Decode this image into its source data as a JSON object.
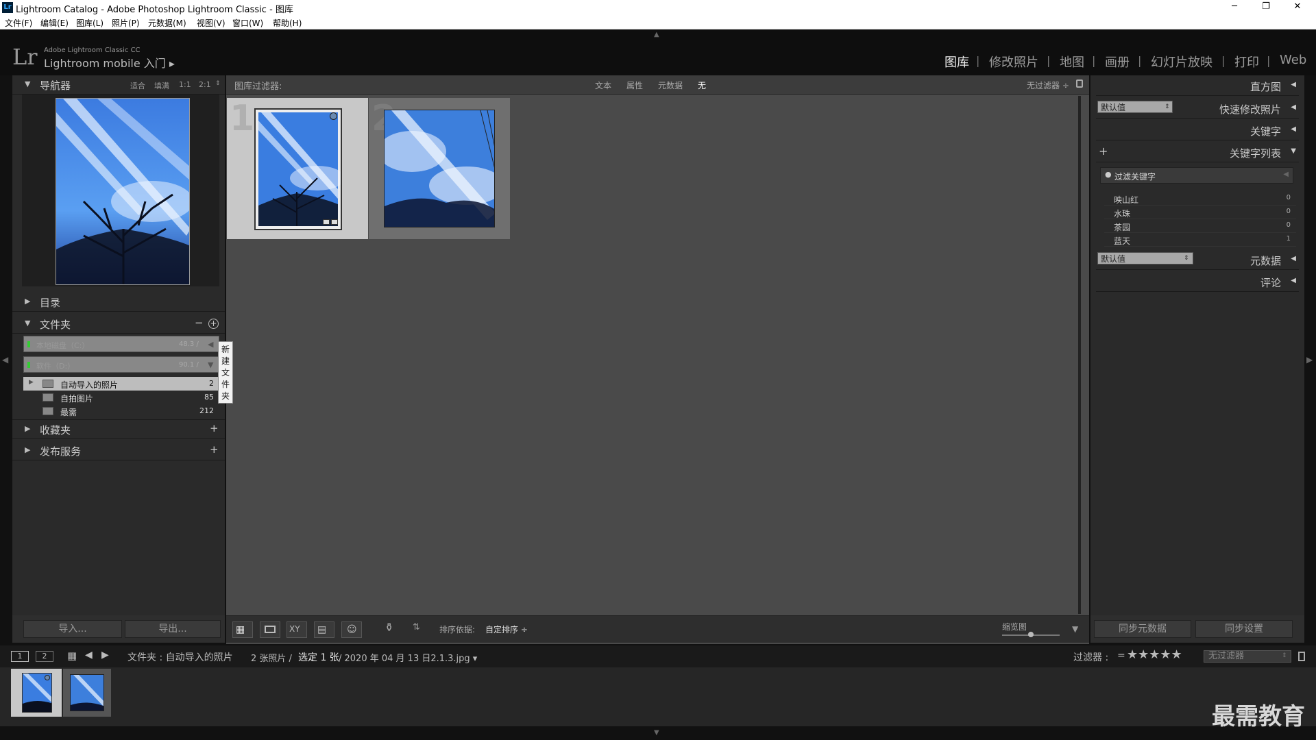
{
  "window": {
    "title": "Lightroom Catalog - Adobe Photoshop Lightroom Classic - 图库",
    "app_icon": "Lr",
    "minimize": "─",
    "restore": "❐",
    "close": "✕"
  },
  "menu": [
    "文件(F)",
    "编辑(E)",
    "图库(L)",
    "照片(P)",
    "元数据(M)",
    "视图(V)",
    "窗口(W)",
    "帮助(H)"
  ],
  "identity": {
    "logo": "Lr",
    "product": "Adobe Lightroom Classic CC",
    "mobile": "Lightroom mobile 入门 ▸"
  },
  "modules": [
    "图库",
    "修改照片",
    "地图",
    "画册",
    "幻灯片放映",
    "打印",
    "Web"
  ],
  "module_sep": "|",
  "left": {
    "navigator": {
      "label": "导航器",
      "zoom": [
        "适合",
        "填满",
        "1:1",
        "2:1"
      ]
    },
    "catalog": {
      "label": "目录"
    },
    "folders": {
      "label": "文件夹",
      "minus": "−",
      "plus": "+",
      "tooltip": "新建文件夹",
      "volumes": [
        {
          "name": "本地磁盘（C:）",
          "size": "48.3 /"
        },
        {
          "name": "软件（D:）",
          "size": "90.1 /"
        }
      ],
      "items": [
        {
          "name": "自动导入的照片",
          "count": "2"
        },
        {
          "name": "自拍图片",
          "count": "85"
        },
        {
          "name": "最需",
          "count": "212"
        }
      ]
    },
    "collections": {
      "label": "收藏夹",
      "plus": "+"
    },
    "publish": {
      "label": "发布服务",
      "plus": "+"
    },
    "import_btn": "导入...",
    "export_btn": "导出..."
  },
  "filter_bar": {
    "label": "图库过滤器:",
    "options": [
      "文本",
      "属性",
      "元数据",
      "无"
    ],
    "preset": "无过滤器 ÷"
  },
  "grid": {
    "cells": [
      "1",
      "2"
    ]
  },
  "toolbar": {
    "sort_label": "排序依据:",
    "sort_value": "自定排序 ÷",
    "thumb_label": "缩览图"
  },
  "right": {
    "histogram": "直方图",
    "quick_dev": "快速修改照片",
    "preset_default": "默认值",
    "keywording": "关键字",
    "keyword_list": "关键字列表",
    "add": "+",
    "filter_placeholder": "过滤关键字",
    "keywords": [
      {
        "name": "映山红",
        "count": "0"
      },
      {
        "name": "水珠",
        "count": "0"
      },
      {
        "name": "茶园",
        "count": "0"
      },
      {
        "name": "蓝天",
        "count": "1"
      }
    ],
    "metadata": "元数据",
    "metadata_default": "默认值",
    "comments": "评论",
    "sync_meta": "同步元数据",
    "sync_settings": "同步设置"
  },
  "filmstrip": {
    "page1": "1",
    "page2": "2",
    "path": "文件夹 : 自动导入的照片",
    "count": "2 张照片 /",
    "selected": "选定 1 张",
    "filename": "/ 2020 年 04 月 13 日2.1.3.jpg ▾",
    "filter_label": "过滤器 :",
    "filter_op": "=",
    "stars": "★★★★★",
    "filter_value": "无过滤器"
  },
  "watermark": "最需教育"
}
